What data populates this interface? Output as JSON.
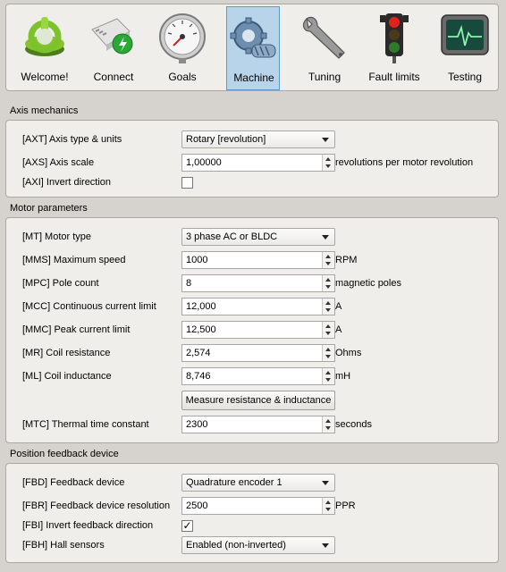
{
  "toolbar": {
    "items": [
      {
        "label": "Welcome!",
        "icon": "power-icon"
      },
      {
        "label": "Connect",
        "icon": "network-plug-icon"
      },
      {
        "label": "Goals",
        "icon": "gauge-icon"
      },
      {
        "label": "Machine",
        "icon": "gears-icon",
        "active": true
      },
      {
        "label": "Tuning",
        "icon": "wrench-icon"
      },
      {
        "label": "Fault limits",
        "icon": "traffic-light-icon"
      },
      {
        "label": "Testing",
        "icon": "oscilloscope-icon"
      }
    ]
  },
  "axis_mechanics": {
    "title": "Axis mechanics",
    "axis_type_label": "[AXT] Axis type & units",
    "axis_type_value": "Rotary [revolution]",
    "axis_scale_label": "[AXS] Axis scale",
    "axis_scale_value": "1,00000",
    "axis_scale_unit": "revolutions per motor revolution",
    "invert_label": "[AXI] Invert direction",
    "invert_checked": false
  },
  "motor": {
    "title": "Motor parameters",
    "type_label": "[MT] Motor type",
    "type_value": "3 phase AC or BLDC",
    "max_speed_label": "[MMS] Maximum speed",
    "max_speed_value": "1000",
    "max_speed_unit": "RPM",
    "pole_label": "[MPC] Pole count",
    "pole_value": "8",
    "pole_unit": "magnetic poles",
    "cont_label": "[MCC] Continuous current limit",
    "cont_value": "12,000",
    "cont_unit": "A",
    "peak_label": "[MMC] Peak current limit",
    "peak_value": "12,500",
    "peak_unit": "A",
    "res_label": "[MR] Coil resistance",
    "res_value": "2,574",
    "res_unit": "Ohms",
    "ind_label": "[ML] Coil inductance",
    "ind_value": "8,746",
    "ind_unit": "mH",
    "measure_button": "Measure resistance & inductance",
    "thermal_label": "[MTC] Thermal time constant",
    "thermal_value": "2300",
    "thermal_unit": "seconds"
  },
  "feedback": {
    "title": "Position feedback device",
    "device_label": "[FBD] Feedback device",
    "device_value": "Quadrature encoder 1",
    "res_label": "[FBR] Feedback device resolution",
    "res_value": "2500",
    "res_unit": "PPR",
    "invert_label": "[FBI] Invert feedback direction",
    "invert_mark": "✓",
    "hall_label": "[FBH] Hall sensors",
    "hall_value": "Enabled (non-inverted)"
  }
}
